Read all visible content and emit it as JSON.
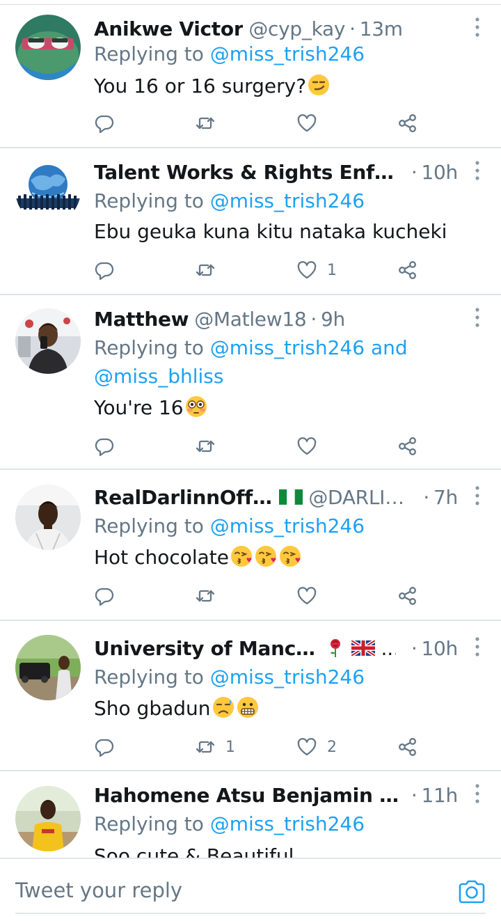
{
  "composer": {
    "placeholder": "Tweet your reply"
  },
  "tweets": [
    {
      "name": "Anikwe Victor",
      "handle": "@cyp_kay",
      "time": "13m",
      "reply_prefix": "Replying to ",
      "mentions": "@miss_trish246",
      "text": "You 16 or 16 surgery?",
      "retweets": "",
      "likes": ""
    },
    {
      "name": "Talent Works & Rights Enforcem...",
      "handle": "",
      "time": "10h",
      "reply_prefix": "Replying to ",
      "mentions": "@miss_trish246",
      "text": "Ebu geuka kuna kitu nataka kucheki",
      "retweets": "",
      "likes": "1"
    },
    {
      "name": "Matthew",
      "handle": "@Matlew18",
      "time": "9h",
      "reply_prefix": "Replying to ",
      "mentions": "@miss_trish246 and",
      "mentions_line2": "@miss_bhliss",
      "text": "You're 16",
      "retweets": "",
      "likes": ""
    },
    {
      "name": "RealDarlinnOfficial",
      "handle": "@DARLINT...",
      "time": "7h",
      "reply_prefix": "Replying to ",
      "mentions": "@miss_trish246",
      "text": "Hot chocolate",
      "retweets": "",
      "likes": ""
    },
    {
      "name": "University of Manchester",
      "name_suffix": "...",
      "handle": "",
      "time": "10h",
      "reply_prefix": "Replying to ",
      "mentions": "@miss_trish246",
      "text": "Sho gbadun",
      "retweets": "1",
      "likes": "2"
    },
    {
      "name": "Hahomene Atsu Benjamin Faith...",
      "handle": "",
      "time": "11h",
      "reply_prefix": "Replying to ",
      "mentions": "@miss_trish246",
      "text": "Soo cute & Beautiful",
      "retweets": "",
      "likes": ""
    }
  ],
  "icons": {
    "more": "more-vertical-icon",
    "reply": "reply-icon",
    "retweet": "retweet-icon",
    "like": "heart-icon",
    "share": "share-icon",
    "camera": "camera-icon"
  },
  "colors": {
    "text": "#14171a",
    "muted": "#657786",
    "link": "#1da1f2",
    "divider": "#dfe3e7"
  }
}
